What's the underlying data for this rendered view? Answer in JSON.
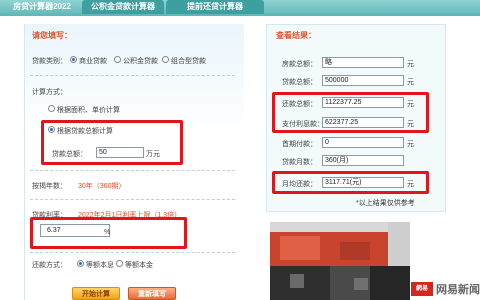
{
  "tabs": [
    {
      "label": "房贷计算器2022"
    },
    {
      "label": "公积金贷款计算器"
    },
    {
      "label": "提前还贷计算器"
    }
  ],
  "left": {
    "heading": "请您填写：",
    "loan_type": {
      "label": "贷款类别：",
      "options": [
        "商业贷款",
        "公积金贷款",
        "组合型贷款"
      ],
      "selected": "商业贷款"
    },
    "calc_method": {
      "label": "计算方式：",
      "options": [
        "根据面积、单价计算",
        "根据贷款总额计算"
      ],
      "selected": "根据贷款总额计算"
    },
    "loan_total": {
      "label": "贷款总额：",
      "value": "50",
      "unit": "万元"
    },
    "years": {
      "label": "按揭年数：",
      "value": "30年（360期）"
    },
    "rate": {
      "label": "贷款利率：",
      "value": "2022年2月1日利率上限（1.3倍）",
      "input": "6.37",
      "unit": "%"
    },
    "repay": {
      "label": "还款方式：",
      "options": [
        "等额本息",
        "等额本金"
      ],
      "selected": "等额本息"
    },
    "buttons": {
      "calc": "开始计算",
      "reset": "重新填写"
    }
  },
  "right": {
    "heading": "查看结果：",
    "rows": [
      {
        "label": "房款总额：",
        "value": "略",
        "unit": "元"
      },
      {
        "label": "贷款总额：",
        "value": "500000",
        "unit": "元"
      },
      {
        "label": "还款总额：",
        "value": "1122377.25",
        "unit": "元"
      },
      {
        "label": "支付利息款：",
        "value": "622377.25",
        "unit": "元"
      },
      {
        "label": "首期付款：",
        "value": "0",
        "unit": "元"
      },
      {
        "label": "贷款月数：",
        "value": "360(月)",
        "unit": ""
      },
      {
        "label": "月均还款：",
        "value": "3117.71(元)",
        "unit": "元"
      }
    ],
    "note": "*以上结果仅供参考"
  },
  "watermark": {
    "logo": "網易",
    "text": "网易新闻"
  },
  "colors": {
    "tab_bg": "#5fb7b8",
    "accent_red": "#e5522d",
    "highlight_box": "#e3151a"
  }
}
